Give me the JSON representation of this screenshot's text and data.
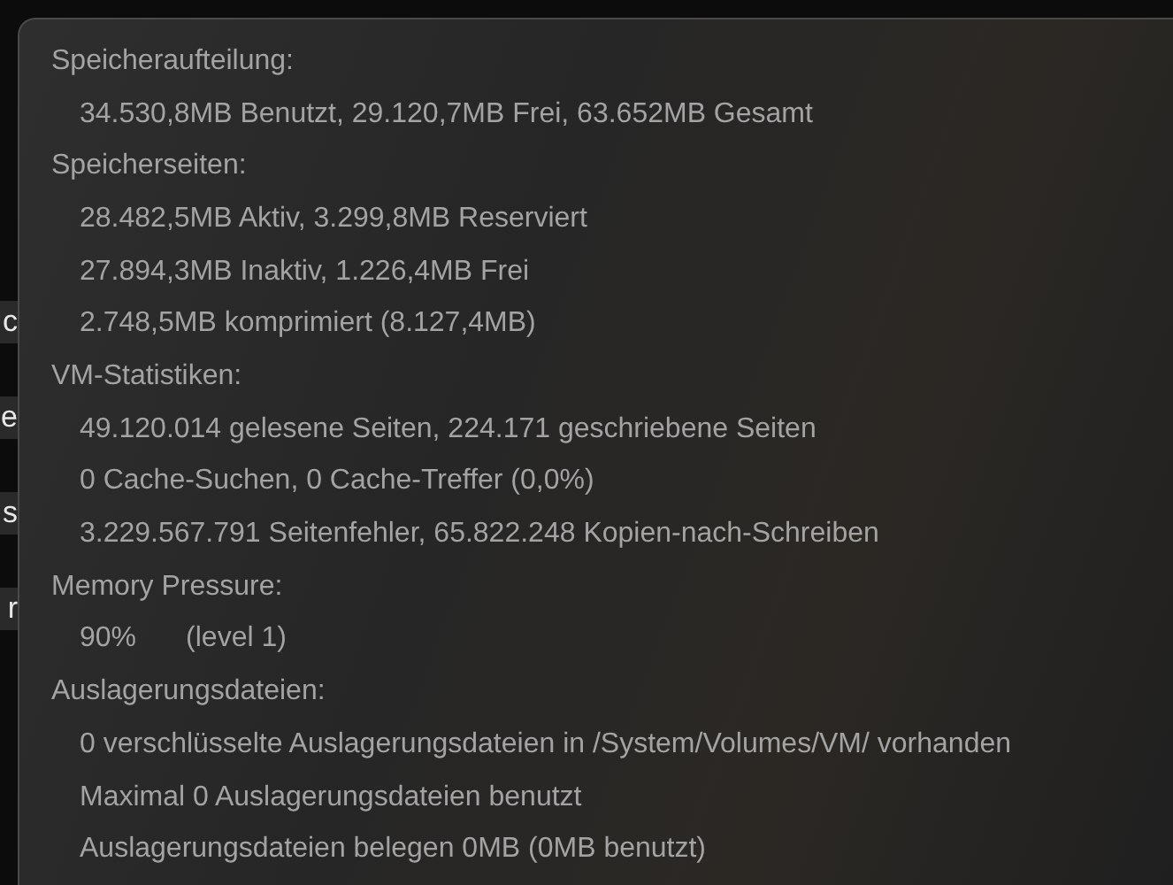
{
  "background_rows": [
    {
      "text": "c"
    },
    {
      "text": "e"
    },
    {
      "text": "s"
    },
    {
      "text": "r"
    }
  ],
  "sections": [
    {
      "heading": "Speicheraufteilung:",
      "lines": [
        {
          "text": "34.530,8MB Benutzt, 29.120,7MB Frei, 63.652MB Gesamt"
        }
      ]
    },
    {
      "heading": "Speicherseiten:",
      "lines": [
        {
          "text": "28.482,5MB Aktiv, 3.299,8MB Reserviert"
        },
        {
          "text": "27.894,3MB Inaktiv, 1.226,4MB Frei"
        },
        {
          "text": "2.748,5MB komprimiert (8.127,4MB)"
        }
      ]
    },
    {
      "heading": "VM-Statistiken:",
      "lines": [
        {
          "text": "49.120.014 gelesene Seiten, 224.171 geschriebene Seiten"
        },
        {
          "text": "0 Cache-Suchen, 0 Cache-Treffer (0,0%)"
        },
        {
          "text": "3.229.567.791 Seitenfehler, 65.822.248 Kopien-nach-Schreiben"
        }
      ]
    },
    {
      "heading": "Memory Pressure:",
      "lines": [
        {
          "text": "90%",
          "note": "(level 1)"
        }
      ]
    },
    {
      "heading": "Auslagerungsdateien:",
      "lines": [
        {
          "text": "0 verschlüsselte Auslagerungsdateien in /System/Volumes/VM/ vorhanden"
        },
        {
          "text": "Maximal 0 Auslagerungsdateien benutzt"
        },
        {
          "text": "Auslagerungsdateien belegen 0MB (0MB benutzt)"
        }
      ]
    }
  ]
}
